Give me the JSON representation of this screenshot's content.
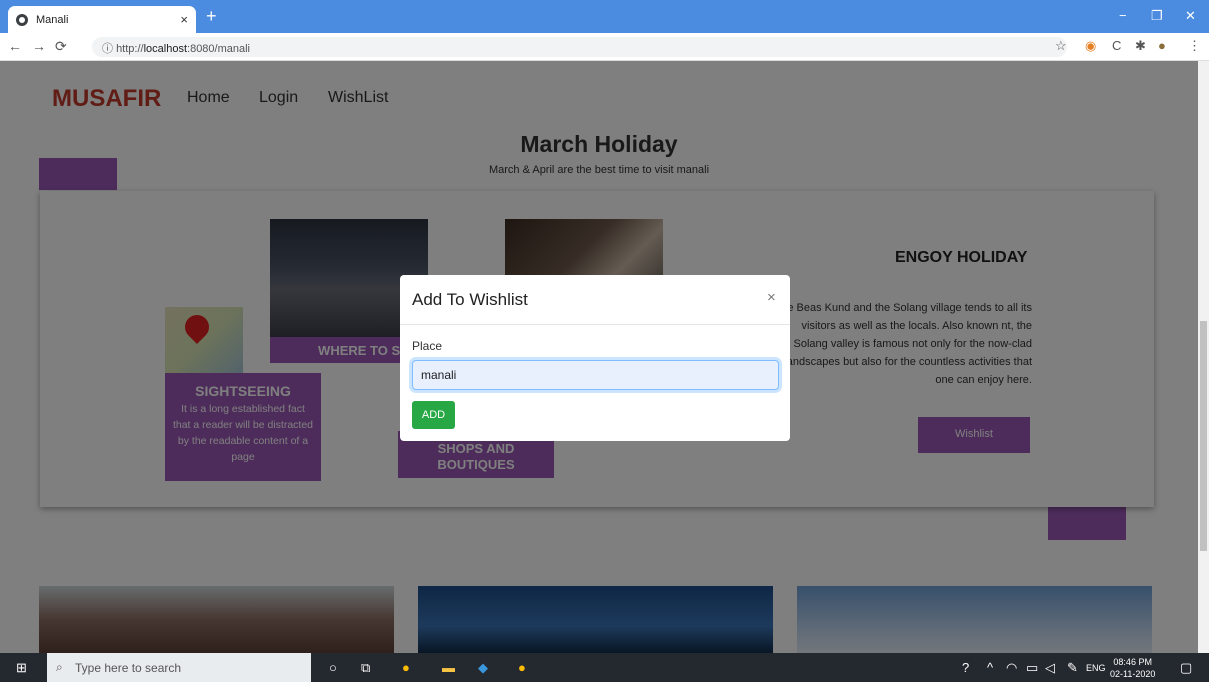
{
  "browser": {
    "tab_title": "Manali",
    "tab_close": "×",
    "new_tab": "+",
    "url_prefix": "http://",
    "url_host": "localhost",
    "url_rest": ":8080/manali",
    "win_min": "−",
    "win_max": "❐",
    "win_close": "✕"
  },
  "navbar": {
    "brand": "MUSAFIR",
    "links": [
      "Home",
      "Login",
      "WishList"
    ]
  },
  "hero": {
    "title": "March Holiday",
    "subtitle": "March & April are the best time to visit manali"
  },
  "card": {
    "sightseeing_title": "SIGHTSEEING",
    "sightseeing_text": "It is a long established fact that a reader will be distracted by the readable content of a page",
    "where_to_stay": "WHERE TO STAY",
    "shops": "SHOPS AND BOUTIQUES",
    "engoy_title": "ENGOY HOLIDAY",
    "engoy_text": "the Beas Kund and the Solang village tends to all its visitors as well as the locals. Also known nt, the Solang valley is famous not only for the now-clad landscapes but also for the countless activities that one can enjoy here.",
    "wishlist_button": "Wishlist"
  },
  "modal": {
    "title": "Add To Wishlist",
    "close": "×",
    "label": "Place",
    "value": "manali",
    "button": "ADD"
  },
  "taskbar": {
    "search_placeholder": "Type here to search",
    "lang": "ENG",
    "time": "08:46 PM",
    "date": "02-11-2020"
  }
}
